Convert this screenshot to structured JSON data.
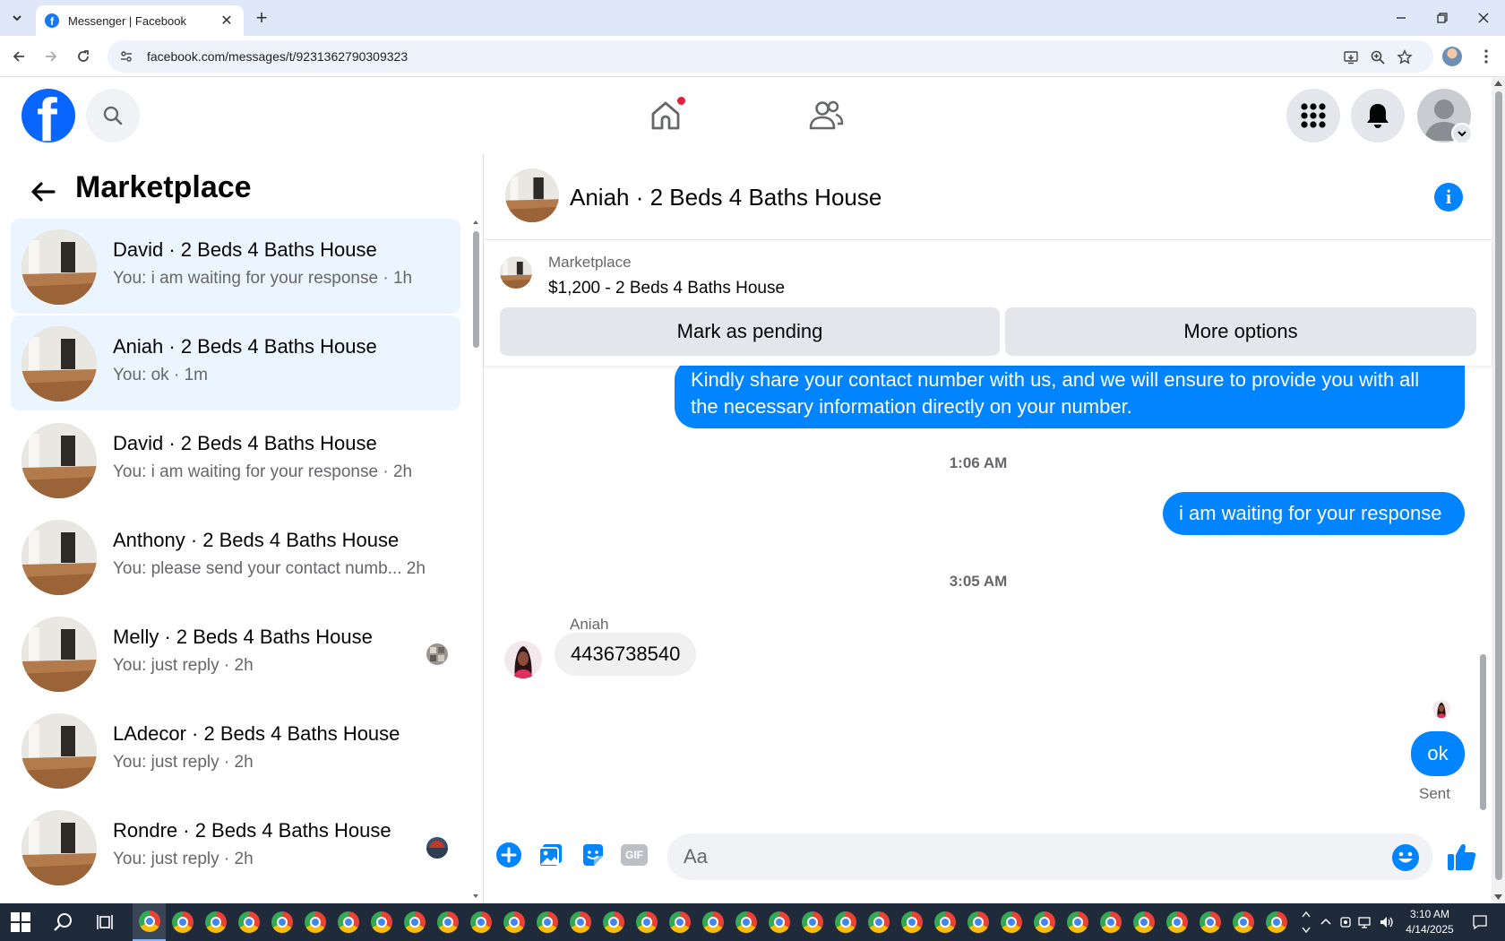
{
  "browser": {
    "tab_title": "Messenger | Facebook",
    "url": "facebook.com/messages/t/9231362790309323"
  },
  "sidebar": {
    "title": "Marketplace",
    "conversations": [
      {
        "name": "David · 2 Beds 4 Baths House",
        "preview": "You: i am waiting for your response · 1h",
        "selected": true
      },
      {
        "name": "Aniah · 2 Beds 4 Baths House",
        "preview": "You: ok · 1m",
        "selected": true
      },
      {
        "name": "David · 2 Beds 4 Baths House",
        "preview": "You: i am waiting for your response · 2h",
        "selected": false
      },
      {
        "name": "Anthony · 2 Beds 4 Baths House",
        "preview": "You: please send your contact numb...  2h",
        "selected": false
      },
      {
        "name": "Melly · 2 Beds 4 Baths House",
        "preview": "You: just reply · 2h",
        "selected": false
      },
      {
        "name": "LAdecor · 2 Beds 4 Baths House",
        "preview": "You: just reply · 2h",
        "selected": false
      },
      {
        "name": "Rondre · 2 Beds 4 Baths House",
        "preview": "You: just reply · 2h",
        "selected": false
      }
    ]
  },
  "chat": {
    "title": "Aniah · 2 Beds 4 Baths House",
    "listing": {
      "kind": "Marketplace",
      "title": "$1,200 - 2 Beds 4 Baths House",
      "pending_label": "Mark as pending",
      "options_label": "More options"
    },
    "messages": {
      "out_1": "Kindly share your contact number with us, and we will ensure to provide you with all the necessary information directly on your number.",
      "time_1": "1:06 AM",
      "out_2": "i am waiting for your response",
      "time_2": "3:05 AM",
      "sender": "Aniah",
      "in_1": "4436738540",
      "out_3": "ok",
      "status": "Sent"
    },
    "composer": {
      "placeholder": "Aa",
      "gif_label": "GIF"
    }
  },
  "taskbar": {
    "time": "3:10 AM",
    "date": "4/14/2025"
  },
  "colors": {
    "messenger_blue": "#0084ff",
    "facebook_blue": "#0866ff",
    "selected_row": "#ebf5ff"
  }
}
